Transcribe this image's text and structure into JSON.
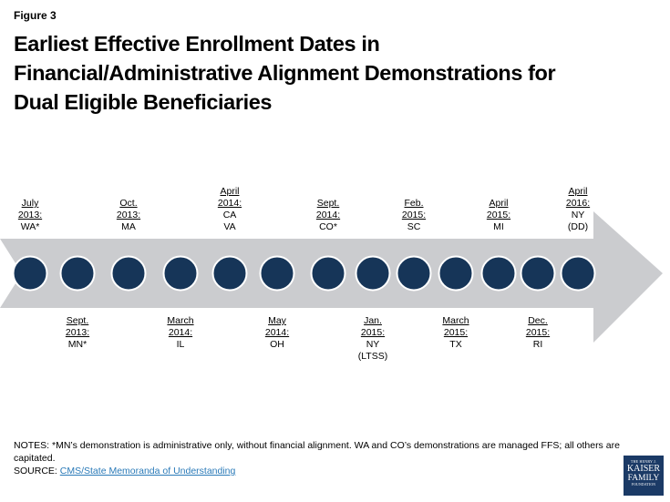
{
  "figure_label": "Figure 3",
  "title_lines": [
    "Earliest Effective Enrollment Dates in",
    "Financial/Administrative Alignment Demonstrations for",
    "Dual Eligible Beneficiaries"
  ],
  "colors": {
    "arrow": "#cbcccf",
    "circle": "#163558",
    "circle_border": "#ffffff",
    "link": "#2a7ab8",
    "logo_bg": "#1b3a66"
  },
  "milestones": [
    {
      "position": "top",
      "date_lines": [
        "July",
        "2013:"
      ],
      "states": [
        "WA*"
      ]
    },
    {
      "position": "bottom",
      "date_lines": [
        "Sept.",
        "2013:"
      ],
      "states": [
        "MN*"
      ]
    },
    {
      "position": "top",
      "date_lines": [
        "Oct.",
        "2013:"
      ],
      "states": [
        "MA"
      ]
    },
    {
      "position": "bottom",
      "date_lines": [
        "March",
        "2014:"
      ],
      "states": [
        "IL"
      ]
    },
    {
      "position": "top",
      "date_lines": [
        "April",
        "2014:"
      ],
      "states": [
        "CA",
        "VA"
      ]
    },
    {
      "position": "bottom",
      "date_lines": [
        "May",
        "2014:"
      ],
      "states": [
        "OH"
      ]
    },
    {
      "position": "top",
      "date_lines": [
        "Sept.",
        "2014:"
      ],
      "states": [
        "CO*"
      ]
    },
    {
      "position": "bottom",
      "date_lines": [
        "Jan.",
        "2015:"
      ],
      "states": [
        "NY",
        "(LTSS)"
      ]
    },
    {
      "position": "top",
      "date_lines": [
        "Feb.",
        "2015:"
      ],
      "states": [
        "SC"
      ]
    },
    {
      "position": "bottom",
      "date_lines": [
        "March",
        "2015:"
      ],
      "states": [
        "TX"
      ]
    },
    {
      "position": "top",
      "date_lines": [
        "April",
        "2015:"
      ],
      "states": [
        "MI"
      ]
    },
    {
      "position": "bottom",
      "date_lines": [
        "Dec.",
        "2015:"
      ],
      "states": [
        "RI"
      ]
    },
    {
      "position": "top",
      "date_lines": [
        "April",
        "2016:"
      ],
      "states": [
        "NY",
        "(DD)"
      ]
    }
  ],
  "notes": {
    "notes_text": "NOTES:  *MN’s demonstration is administrative  only, without financial alignment.  WA and CO’s demonstrations are managed FFS; all others are capitated.",
    "source_prefix": "SOURCE:  ",
    "source_link": "CMS/State Memoranda of Understanding"
  },
  "logo": {
    "line1": "THE HENRY J.",
    "line2": "KAISER",
    "line3": "FAMILY",
    "line4": "FOUNDATION"
  }
}
